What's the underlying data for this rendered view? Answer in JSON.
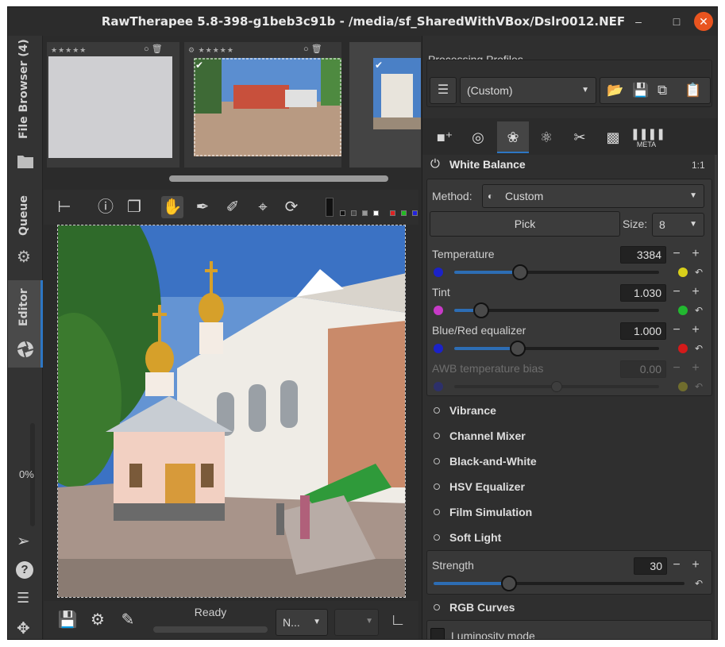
{
  "window": {
    "title": "RawTherapee 5.8-398-g1beb3c91b - /media/sf_SharedWithVBox/Dslr0012.NEF"
  },
  "left_tabs": {
    "file_browser": "File Browser (4)",
    "queue": "Queue",
    "editor": "Editor",
    "progress": "0%"
  },
  "colors": {
    "accent": "#2d76c4",
    "close": "#e9541f",
    "slider_fill": "#2d6db4"
  },
  "processing_profiles": {
    "label": "Processing Profiles",
    "selected": "(Custom)"
  },
  "tool_tabs": [
    "exposure",
    "detail",
    "color",
    "advanced",
    "transform",
    "raw",
    "META"
  ],
  "white_balance": {
    "title": "White Balance",
    "ratio": "1:1",
    "method_label": "Method:",
    "method_value": "Custom",
    "pick_label": "Pick",
    "size_label": "Size:",
    "size_value": "8",
    "sliders": [
      {
        "label": "Temperature",
        "value": "3384",
        "fraction": 0.32
      },
      {
        "label": "Tint",
        "value": "1.030",
        "fraction": 0.13
      },
      {
        "label": "Blue/Red equalizer",
        "value": "1.000",
        "fraction": 0.31
      },
      {
        "label": "AWB temperature bias",
        "value": "0.00",
        "fraction": 0.5,
        "disabled": true
      }
    ]
  },
  "tools": [
    "Vibrance",
    "Channel Mixer",
    "Black-and-White",
    "HSV Equalizer",
    "Film Simulation",
    "Soft Light"
  ],
  "soft_light": {
    "strength_label": "Strength",
    "strength_value": "30",
    "fraction": 0.3
  },
  "rgb_curves": {
    "title": "RGB Curves",
    "luminosity_label": "Luminosity mode"
  },
  "bottom": {
    "status": "Ready",
    "profile_short": "N..."
  }
}
